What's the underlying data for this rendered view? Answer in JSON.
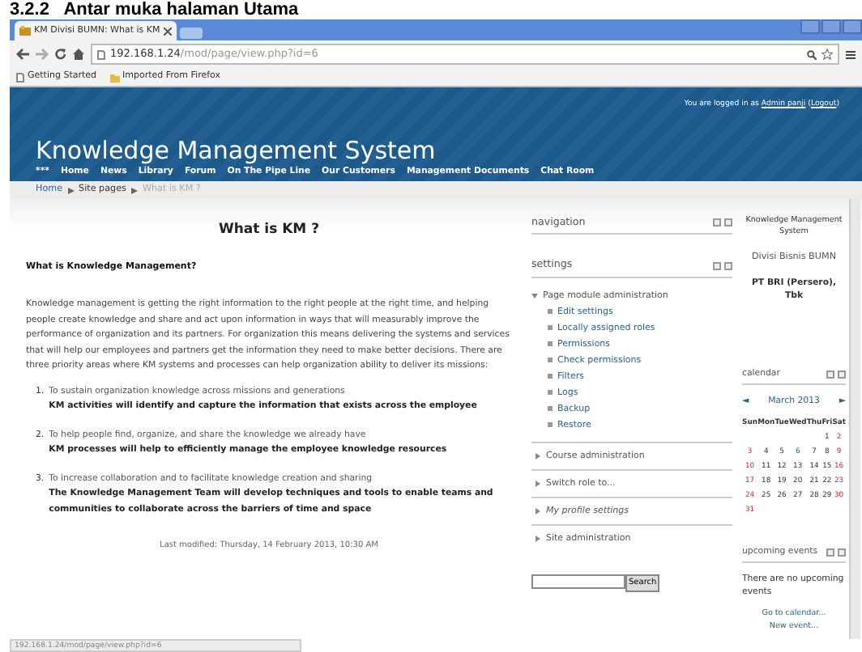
{
  "caption": "3.2.2   Antar muka halaman Utama",
  "browser": {
    "tab_title": "KM Divisi BUMN: What is KM",
    "url_host": "192.168.1.24",
    "url_path": "/mod/page/view.php?id=6",
    "bookmarks": [
      {
        "label": "Getting Started",
        "kind": "page"
      },
      {
        "label": "Imported From Firefox",
        "kind": "folder"
      }
    ]
  },
  "header": {
    "login_prefix": "You are logged in as ",
    "login_user": "Admin panji",
    "login_open": " (",
    "logout": "Logout",
    "login_close": ")",
    "site_title": "Knowledge Management System",
    "menu": [
      "***",
      "Home",
      "News",
      "Library",
      "Forum",
      "On The Pipe Line",
      "Our Customers",
      "Management Documents",
      "Chat Room"
    ]
  },
  "breadcrumb": [
    {
      "label": "Home",
      "current": false
    },
    {
      "label": "Site pages",
      "current": false
    },
    {
      "label": "What is KM ?",
      "current": true
    }
  ],
  "page": {
    "title": "What is KM ?",
    "subtitle": "What is Knowledge Management?",
    "paragraph": "Knowledge management is getting the right information to the right people at the right time, and helping people create knowledge and share and act upon information in ways that will measurably improve the performance of organization and its partners. For organization this means delivering the systems and services that will help our employees and partners get the information they need to make better decisions. There are three priority areas where KM systems and processes can help organization ability to deliver its missions:",
    "missions": [
      {
        "number": "1.",
        "text": "To sustain organization knowledge across missions and generations",
        "detail": "KM activities will identify and capture the information that exists across the employee"
      },
      {
        "number": "2.",
        "text": "To help people find, organize, and share the knowledge we already have",
        "detail": "KM processes will help to efficiently manage the employee knowledge resources"
      },
      {
        "number": "3.",
        "text": "To increase collaboration and to facilitate knowledge creation and sharing",
        "detail": "The Knowledge Management Team will develop techniques and tools to enable teams and communities to collaborate across the barriers of time and space"
      }
    ],
    "last_modified": "Last modified: Thursday, 14 February 2013, 10:30 AM"
  },
  "navigation_block": {
    "title": "navigation"
  },
  "settings_block": {
    "title": "settings",
    "tree": [
      {
        "label": "Page module administration",
        "expanded": true,
        "italic": false,
        "children": [
          {
            "label": "Edit settings"
          },
          {
            "label": "Locally assigned roles"
          },
          {
            "label": "Permissions"
          },
          {
            "label": "Check permissions"
          },
          {
            "label": "Filters"
          },
          {
            "label": "Logs"
          },
          {
            "label": "Backup"
          },
          {
            "label": "Restore"
          }
        ]
      },
      {
        "label": "Course administration",
        "expanded": false,
        "italic": false
      },
      {
        "label": "Switch role to...",
        "expanded": false,
        "italic": false
      },
      {
        "label": "My profile settings",
        "expanded": false,
        "italic": true
      },
      {
        "label": "Site administration",
        "expanded": false,
        "italic": false
      }
    ]
  },
  "search_button": "Search",
  "info": {
    "system": "Knowledge Management System",
    "division": "Divisi Bisnis BUMN",
    "company": "PT BRI (Persero), Tbk"
  },
  "calendar": {
    "title": "calendar",
    "prev": "◄",
    "month": "March 2013",
    "next": "►",
    "weekdays": [
      "Sun",
      "Mon",
      "Tue",
      "Wed",
      "Thu",
      "Fri",
      "Sat"
    ],
    "weeks": [
      [
        {
          "kind": "blank"
        },
        {
          "kind": "blank"
        },
        {
          "kind": "blank"
        },
        {
          "kind": "blank"
        },
        {
          "kind": "blank"
        },
        {
          "day": "1",
          "kind": "normal"
        },
        {
          "day": "2",
          "kind": "weekend"
        }
      ],
      [
        {
          "day": "3",
          "kind": "weekend"
        },
        {
          "day": "4",
          "kind": "normal"
        },
        {
          "day": "5",
          "kind": "normal"
        },
        {
          "day": "6",
          "kind": "today"
        },
        {
          "day": "7",
          "kind": "normal"
        },
        {
          "day": "8",
          "kind": "normal"
        },
        {
          "day": "9",
          "kind": "weekend"
        }
      ],
      [
        {
          "day": "10",
          "kind": "weekend"
        },
        {
          "day": "11",
          "kind": "normal"
        },
        {
          "day": "12",
          "kind": "normal"
        },
        {
          "day": "13",
          "kind": "normal"
        },
        {
          "day": "14",
          "kind": "normal"
        },
        {
          "day": "15",
          "kind": "normal"
        },
        {
          "day": "16",
          "kind": "weekend"
        }
      ],
      [
        {
          "day": "17",
          "kind": "weekend"
        },
        {
          "day": "18",
          "kind": "normal"
        },
        {
          "day": "19",
          "kind": "normal"
        },
        {
          "day": "20",
          "kind": "normal"
        },
        {
          "day": "21",
          "kind": "normal"
        },
        {
          "day": "22",
          "kind": "normal"
        },
        {
          "day": "23",
          "kind": "weekend"
        }
      ],
      [
        {
          "day": "24",
          "kind": "weekend"
        },
        {
          "day": "25",
          "kind": "normal"
        },
        {
          "day": "26",
          "kind": "normal"
        },
        {
          "day": "27",
          "kind": "normal"
        },
        {
          "day": "28",
          "kind": "normal"
        },
        {
          "day": "29",
          "kind": "normal"
        },
        {
          "day": "30",
          "kind": "weekend"
        }
      ],
      [
        {
          "day": "31",
          "kind": "weekend"
        }
      ]
    ]
  },
  "upcoming": {
    "title": "upcoming events",
    "message": "There are no upcoming events",
    "links": [
      "Go to calendar...",
      "New event..."
    ]
  },
  "status_bar": "192.168.1.24/mod/page/view.php?id=6"
}
